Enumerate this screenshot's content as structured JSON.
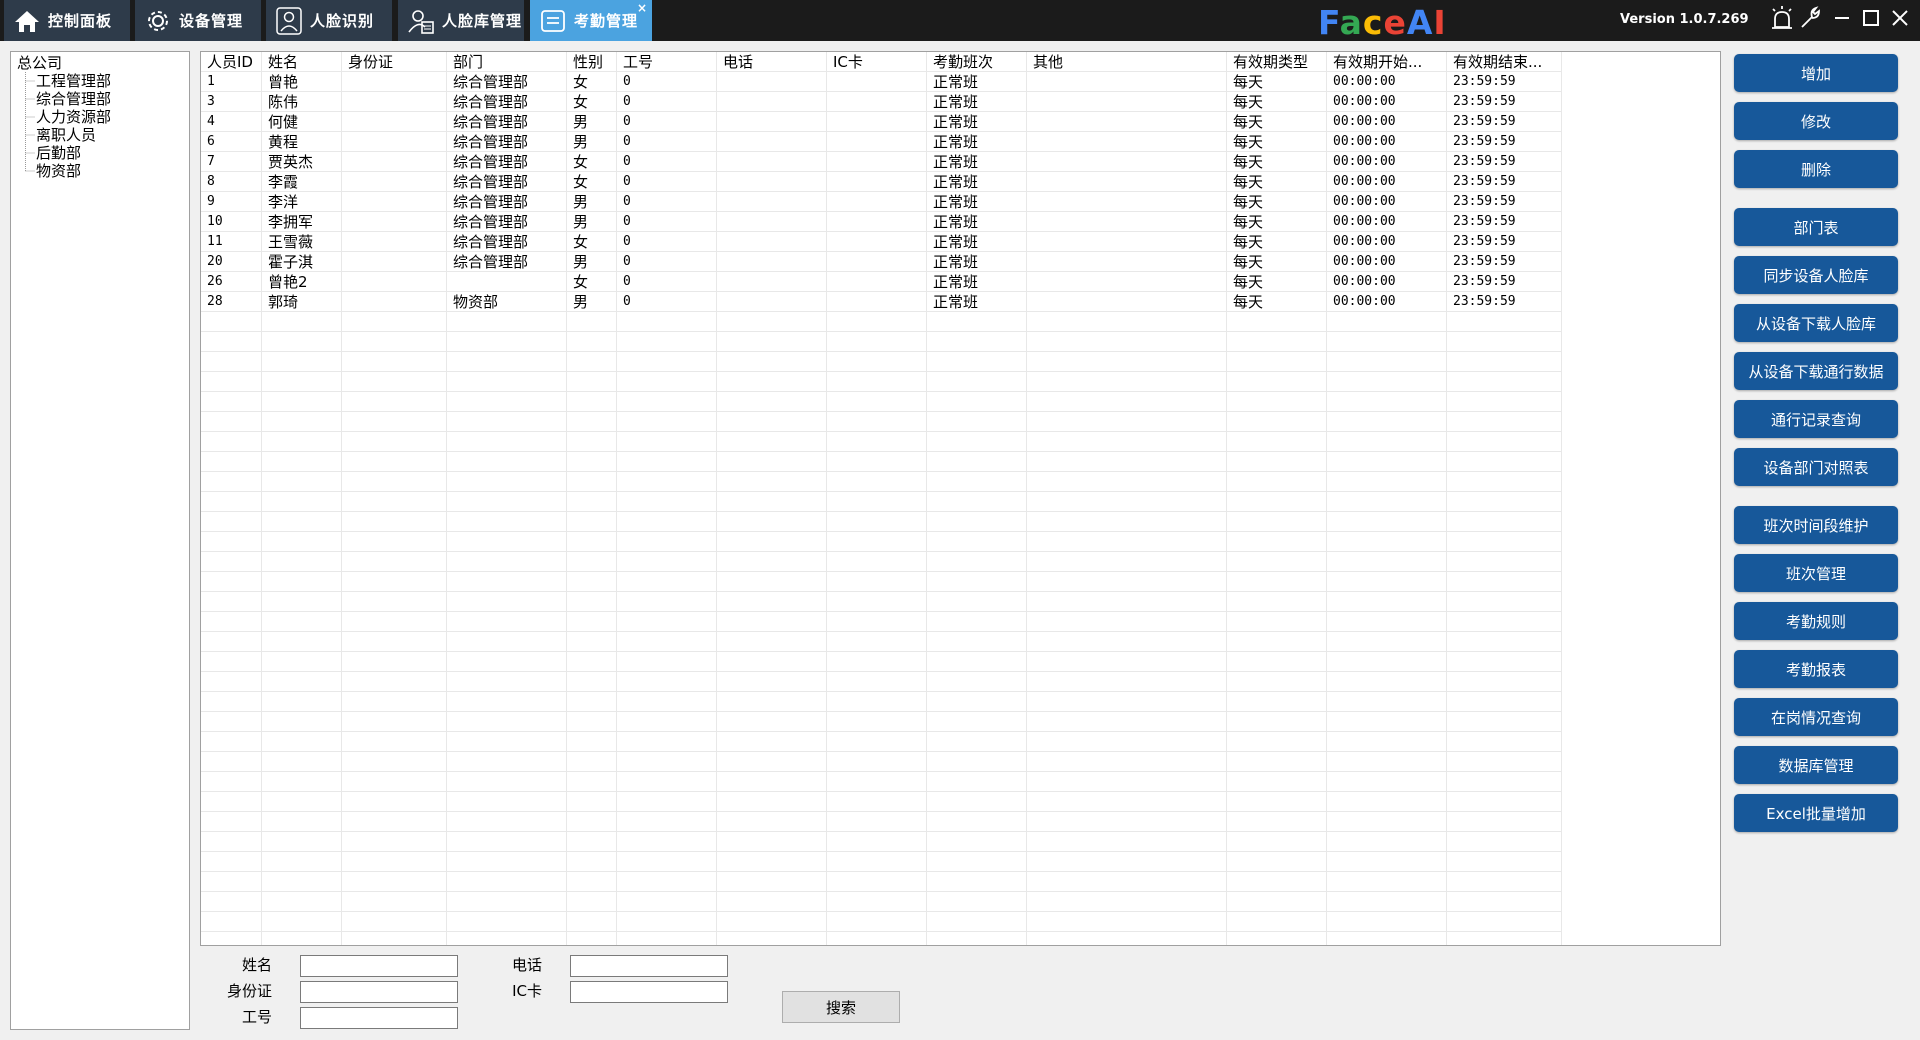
{
  "tabs": [
    {
      "label": "控制面板",
      "icon": "home-icon"
    },
    {
      "label": "设备管理",
      "icon": "gear-icon"
    },
    {
      "label": "人脸识别",
      "icon": "user-icon"
    },
    {
      "label": "人脸库管理",
      "icon": "face-library-icon"
    },
    {
      "label": "考勤管理",
      "icon": "attendance-icon",
      "active": true,
      "close": "×"
    }
  ],
  "app": {
    "logo_letters": [
      "F",
      "a",
      "c",
      "e",
      "A",
      "I"
    ],
    "logo_colors": [
      "#4285f4",
      "#34a853",
      "#fbbc05",
      "#ea4335",
      "#4285f4",
      "#ea4335"
    ],
    "version": "Version 1.0.7.269"
  },
  "tree": {
    "root": "总公司",
    "children": [
      "工程管理部",
      "综合管理部",
      "人力资源部",
      "离职人员",
      "后勤部",
      "物资部"
    ]
  },
  "table": {
    "columns": [
      "人员ID",
      "姓名",
      "身份证",
      "部门",
      "性别",
      "工号",
      "电话",
      "IC卡",
      "考勤班次",
      "其他",
      "有效期类型",
      "有效期开始...",
      "有效期结束..."
    ],
    "rows": [
      [
        "1",
        "曾艳",
        "",
        "综合管理部",
        "女",
        "0",
        "",
        "",
        "正常班",
        "",
        "每天",
        "00:00:00",
        "23:59:59"
      ],
      [
        "3",
        "陈伟",
        "",
        "综合管理部",
        "女",
        "0",
        "",
        "",
        "正常班",
        "",
        "每天",
        "00:00:00",
        "23:59:59"
      ],
      [
        "4",
        "何健",
        "",
        "综合管理部",
        "男",
        "0",
        "",
        "",
        "正常班",
        "",
        "每天",
        "00:00:00",
        "23:59:59"
      ],
      [
        "6",
        "黄程",
        "",
        "综合管理部",
        "男",
        "0",
        "",
        "",
        "正常班",
        "",
        "每天",
        "00:00:00",
        "23:59:59"
      ],
      [
        "7",
        "贾英杰",
        "",
        "综合管理部",
        "女",
        "0",
        "",
        "",
        "正常班",
        "",
        "每天",
        "00:00:00",
        "23:59:59"
      ],
      [
        "8",
        "李霞",
        "",
        "综合管理部",
        "女",
        "0",
        "",
        "",
        "正常班",
        "",
        "每天",
        "00:00:00",
        "23:59:59"
      ],
      [
        "9",
        "李洋",
        "",
        "综合管理部",
        "男",
        "0",
        "",
        "",
        "正常班",
        "",
        "每天",
        "00:00:00",
        "23:59:59"
      ],
      [
        "10",
        "李拥军",
        "",
        "综合管理部",
        "男",
        "0",
        "",
        "",
        "正常班",
        "",
        "每天",
        "00:00:00",
        "23:59:59"
      ],
      [
        "11",
        "王雪薇",
        "",
        "综合管理部",
        "女",
        "0",
        "",
        "",
        "正常班",
        "",
        "每天",
        "00:00:00",
        "23:59:59"
      ],
      [
        "20",
        "霍子淇",
        "",
        "综合管理部",
        "男",
        "0",
        "",
        "",
        "正常班",
        "",
        "每天",
        "00:00:00",
        "23:59:59"
      ],
      [
        "26",
        "曾艳2",
        "",
        "",
        "女",
        "0",
        "",
        "",
        "正常班",
        "",
        "每天",
        "00:00:00",
        "23:59:59"
      ],
      [
        "28",
        "郭琦",
        "",
        "物资部",
        "男",
        "0",
        "",
        "",
        "正常班",
        "",
        "每天",
        "00:00:00",
        "23:59:59"
      ]
    ]
  },
  "search": {
    "name_label": "姓名",
    "id_label": "身份证",
    "jobno_label": "工号",
    "phone_label": "电话",
    "ic_label": "IC卡",
    "name_value": "",
    "id_value": "",
    "jobno_value": "",
    "phone_value": "",
    "ic_value": "",
    "button": "搜索"
  },
  "actions": {
    "add": "增加",
    "edit": "修改",
    "delete": "删除",
    "dept_table": "部门表",
    "sync_faces": "同步设备人脸库",
    "download_faces": "从设备下载人脸库",
    "download_access": "从设备下载通行数据",
    "access_query": "通行记录查询",
    "device_dept_map": "设备部门对照表",
    "shift_periods": "班次时间段维护",
    "shift_manage": "班次管理",
    "attendance_rules": "考勤规则",
    "attendance_report": "考勤报表",
    "on_duty_query": "在岗情况查询",
    "db_manage": "数据库管理",
    "excel_import": "Excel批量增加"
  }
}
